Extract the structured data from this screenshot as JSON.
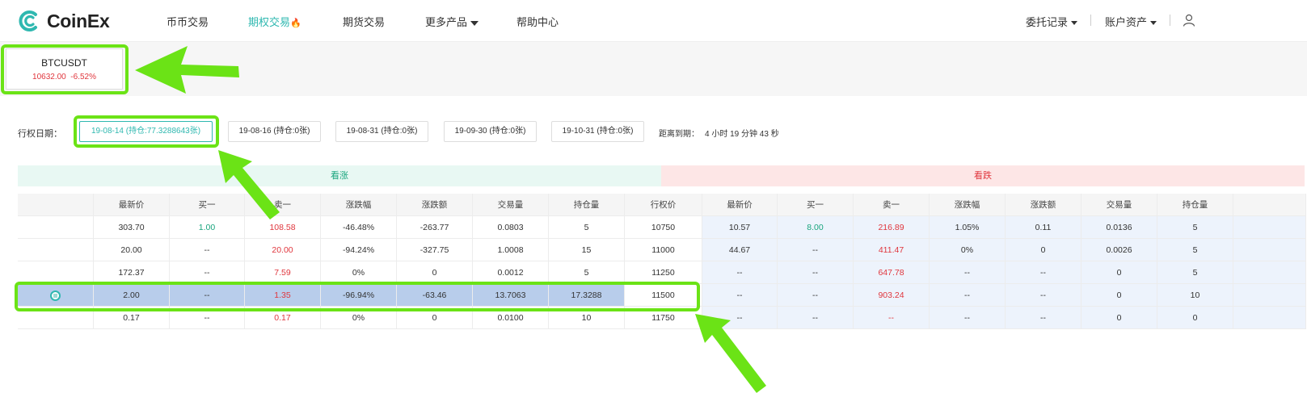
{
  "brand": {
    "name": "CoinEx",
    "color": "#2fb8b0"
  },
  "nav": {
    "items": [
      {
        "label": "币币交易"
      },
      {
        "label": "期权交易",
        "badge": "🔥"
      },
      {
        "label": "期货交易"
      },
      {
        "label": "更多产品"
      },
      {
        "label": "帮助中心"
      }
    ],
    "right": {
      "orders": "委托记录",
      "assets": "账户资产",
      "user_icon": "user-icon"
    }
  },
  "market": {
    "symbol": "BTCUSDT",
    "price": "10632.00",
    "change": "-6.52%"
  },
  "expiry": {
    "label": "行权日期：",
    "options": [
      "19-08-14 (持仓:77.3288643张)",
      "19-08-16 (持仓:0张)",
      "19-08-31 (持仓:0张)",
      "19-09-30 (持仓:0张)",
      "19-10-31 (持仓:0张)"
    ],
    "selected_index": 0,
    "countdown_label": "距离到期：",
    "countdown": "4 小时 19 分钟 43 秒"
  },
  "sections": {
    "call": "看涨",
    "put": "看跌"
  },
  "table": {
    "headers": [
      "",
      "最新价",
      "买一",
      "卖一",
      "涨跌幅",
      "涨跌额",
      "交易量",
      "持仓量",
      "行权价",
      "最新价",
      "买一",
      "卖一",
      "涨跌幅",
      "涨跌额",
      "交易量",
      "持仓量",
      ""
    ],
    "rows": [
      {
        "call": [
          "",
          "303.70",
          "1.00",
          "108.58",
          "-46.48%",
          "-263.77",
          "0.0803",
          "5"
        ],
        "strike": "10750",
        "put": [
          "10.57",
          "8.00",
          "216.89",
          "1.05%",
          "0.11",
          "0.0136",
          "5",
          ""
        ]
      },
      {
        "call": [
          "",
          "20.00",
          "--",
          "20.00",
          "-94.24%",
          "-327.75",
          "1.0008",
          "15"
        ],
        "strike": "11000",
        "put": [
          "44.67",
          "--",
          "411.47",
          "0%",
          "0",
          "0.0026",
          "5",
          ""
        ]
      },
      {
        "call": [
          "",
          "172.37",
          "--",
          "7.59",
          "0%",
          "0",
          "0.0012",
          "5"
        ],
        "strike": "11250",
        "put": [
          "--",
          "--",
          "647.78",
          "--",
          "--",
          "0",
          "5",
          ""
        ]
      },
      {
        "call": [
          "",
          "2.00",
          "--",
          "1.35",
          "-96.94%",
          "-63.46",
          "13.7063",
          "17.3288"
        ],
        "strike": "11500",
        "put": [
          "--",
          "--",
          "903.24",
          "--",
          "--",
          "0",
          "10",
          ""
        ],
        "selected": true
      },
      {
        "call": [
          "",
          "0.17",
          "--",
          "0.17",
          "0%",
          "0",
          "0.0100",
          "10"
        ],
        "strike": "11750",
        "put": [
          "--",
          "--",
          "--",
          "--",
          "--",
          "0",
          "0",
          ""
        ]
      }
    ]
  },
  "colors": {
    "accent": "#2fb8b0",
    "up": "#1aa57e",
    "down": "#e0363d",
    "annotation": "#6be316",
    "highlight_row": "#b8cdeb",
    "put_bg": "#edf3fc"
  }
}
